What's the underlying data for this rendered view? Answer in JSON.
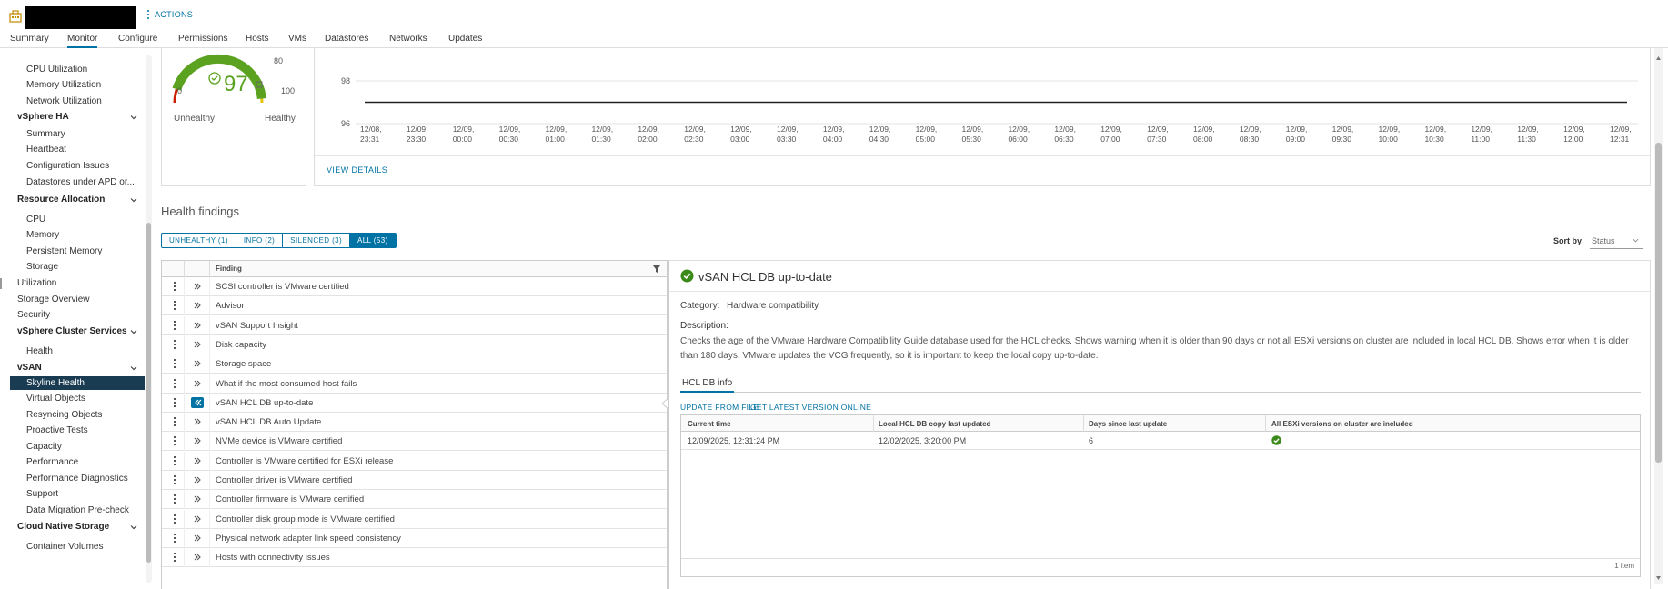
{
  "header": {
    "actions_label": "ACTIONS"
  },
  "tabs": [
    "Summary",
    "Monitor",
    "Configure",
    "Permissions",
    "Hosts",
    "VMs",
    "Datastores",
    "Networks",
    "Updates"
  ],
  "active_tab": "Monitor",
  "sidebar": {
    "items": [
      {
        "type": "sub",
        "label": "CPU Utilization"
      },
      {
        "type": "sub",
        "label": "Memory Utilization"
      },
      {
        "type": "sub",
        "label": "Network Utilization"
      },
      {
        "type": "head",
        "label": "vSphere HA"
      },
      {
        "type": "sub",
        "label": "Summary"
      },
      {
        "type": "sub",
        "label": "Heartbeat"
      },
      {
        "type": "sub",
        "label": "Configuration Issues"
      },
      {
        "type": "sub",
        "label": "Datastores under APD or..."
      },
      {
        "type": "head",
        "label": "Resource Allocation"
      },
      {
        "type": "sub",
        "label": "CPU"
      },
      {
        "type": "sub",
        "label": "Memory"
      },
      {
        "type": "sub",
        "label": "Persistent Memory"
      },
      {
        "type": "sub",
        "label": "Storage"
      },
      {
        "type": "top",
        "label": "Utilization"
      },
      {
        "type": "top",
        "label": "Storage Overview"
      },
      {
        "type": "top",
        "label": "Security"
      },
      {
        "type": "head",
        "label": "vSphere Cluster Services"
      },
      {
        "type": "sub",
        "label": "Health"
      },
      {
        "type": "head",
        "label": "vSAN"
      },
      {
        "type": "sub",
        "label": "Skyline Health",
        "selected": true
      },
      {
        "type": "sub",
        "label": "Virtual Objects"
      },
      {
        "type": "sub",
        "label": "Resyncing Objects"
      },
      {
        "type": "sub",
        "label": "Proactive Tests"
      },
      {
        "type": "sub",
        "label": "Capacity"
      },
      {
        "type": "sub",
        "label": "Performance"
      },
      {
        "type": "sub",
        "label": "Performance Diagnostics"
      },
      {
        "type": "sub",
        "label": "Support"
      },
      {
        "type": "sub",
        "label": "Data Migration Pre-check"
      },
      {
        "type": "head",
        "label": "Cloud Native Storage"
      },
      {
        "type": "sub",
        "label": "Container Volumes"
      }
    ]
  },
  "gauge": {
    "score": "97",
    "score_value": 97,
    "label_0": "0",
    "label_80": "80",
    "label_100": "100",
    "unhealthy_label": "Unhealthy",
    "healthy_label": "Healthy",
    "colors": {
      "red": "#c92100",
      "yellow": "#e6c200",
      "green": "#5aa220"
    }
  },
  "chart_data": {
    "type": "line",
    "y_ticks": [
      "98",
      "96"
    ],
    "ylim": [
      96,
      98
    ],
    "x_labels": [
      "12/08, 23:31",
      "12/09, 23:30",
      "12/09, 00:00",
      "12/09, 00:30",
      "12/09, 01:00",
      "12/09, 01:30",
      "12/09, 02:00",
      "12/09, 02:30",
      "12/09, 03:00",
      "12/09, 03:30",
      "12/09, 04:00",
      "12/09, 04:30",
      "12/09, 05:00",
      "12/09, 05:30",
      "12/09, 06:00",
      "12/09, 06:30",
      "12/09, 07:00",
      "12/09, 07:30",
      "12/09, 08:00",
      "12/09, 08:30",
      "12/09, 09:00",
      "12/09, 09:30",
      "12/09, 10:00",
      "12/09, 10:30",
      "12/09, 11:00",
      "12/09, 11:30",
      "12/09, 12:00",
      "12/09, 12:31"
    ],
    "series": [
      {
        "values": [
          97,
          97,
          97,
          97,
          97,
          97,
          97,
          97,
          97,
          97,
          97,
          97,
          97,
          97,
          97,
          97,
          97,
          97,
          97,
          97,
          97,
          97,
          97,
          97,
          97,
          97,
          97,
          97,
          97
        ]
      }
    ],
    "view_details": "VIEW DETAILS"
  },
  "health_findings": {
    "title": "Health findings",
    "filters": [
      "UNHEALTHY (1)",
      "INFO (2)",
      "SILENCED (3)",
      "ALL (53)"
    ],
    "active_filter": "ALL (53)",
    "sort_label": "Sort by",
    "sort_value": "Status",
    "column_header": "Finding",
    "rows": [
      "SCSI controller is VMware certified",
      "Advisor",
      "vSAN Support Insight",
      "Disk capacity",
      "Storage space",
      "What if the most consumed host fails",
      "vSAN HCL DB up-to-date",
      "vSAN HCL DB Auto Update",
      "NVMe device is VMware certified",
      "Controller is VMware certified for ESXi release",
      "Controller driver is VMware certified",
      "Controller firmware is VMware certified",
      "Controller disk group mode is VMware certified",
      "Physical network adapter link speed consistency",
      "Hosts with connectivity issues"
    ],
    "selected_row": "vSAN HCL DB up-to-date"
  },
  "detail": {
    "title": "vSAN HCL DB up-to-date",
    "category_label": "Category:",
    "category_value": "Hardware compatibility",
    "description_label": "Description:",
    "description": "Checks the age of the VMware Hardware Compatibility Guide database used for the HCL checks. Shows warning when it is older than 90 days or not all ESXi versions on cluster are included in local HCL DB. Shows error when it is older than 180 days. VMware updates the VCG frequently, so it is important to keep the local copy up-to-date.",
    "subtab": "HCL DB info",
    "links": [
      "UPDATE FROM FILE",
      "GET LATEST VERSION ONLINE"
    ],
    "table": {
      "headers": [
        "Current time",
        "Local HCL DB copy last updated",
        "Days since last update",
        "All ESXi versions on cluster are included"
      ],
      "row": {
        "current_time": "12/09/2025, 12:31:24 PM",
        "last_updated": "12/02/2025, 3:20:00 PM",
        "days": "6",
        "all_included": "ok"
      },
      "footer": "1 item"
    },
    "status_color": "#3c8a1c"
  }
}
